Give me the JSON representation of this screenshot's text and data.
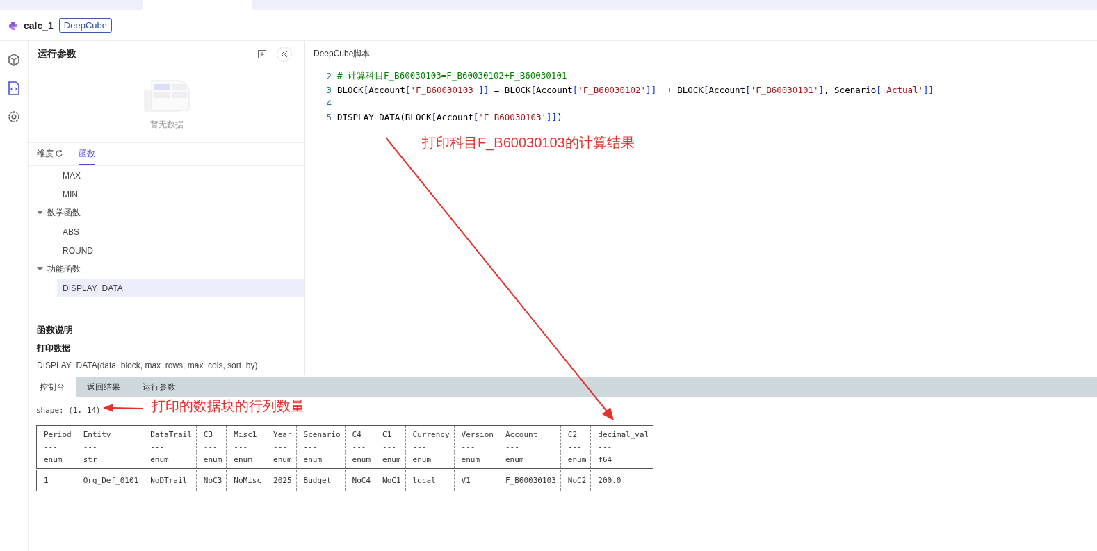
{
  "top_tabs": [
    {
      "selected": true
    }
  ],
  "header": {
    "title": "calc_1",
    "tag": "DeepCube"
  },
  "rail": [
    {
      "kind": "cube",
      "selected": false
    },
    {
      "kind": "script",
      "selected": true
    },
    {
      "kind": "settings",
      "selected": false
    }
  ],
  "params_panel": {
    "title": "运行参数",
    "empty_text": "暂无数据"
  },
  "side_tabs": [
    {
      "label": "维度",
      "selected": false,
      "refresh": true
    },
    {
      "label": "函数",
      "selected": true,
      "refresh": false
    }
  ],
  "tree": [
    {
      "kind": "leaf",
      "label": "MAX",
      "selected": false
    },
    {
      "kind": "leaf",
      "label": "MIN",
      "selected": false
    },
    {
      "kind": "group",
      "label": "数学函数",
      "expanded": true,
      "children": [
        {
          "label": "ABS",
          "selected": false
        },
        {
          "label": "ROUND",
          "selected": false
        }
      ]
    },
    {
      "kind": "group",
      "label": "功能函数",
      "expanded": true,
      "children": [
        {
          "label": "DISPLAY_DATA",
          "selected": true
        }
      ]
    }
  ],
  "description": {
    "title": "函数说明",
    "name": "打印数据",
    "signature": "DISPLAY_DATA(data_block, max_rows, max_cols, sort_by)"
  },
  "editor": {
    "title": "DeepCube脚本",
    "lines": [
      {
        "number": "2",
        "tokens": [
          {
            "kind": "comment",
            "text": "# 计算科目F_B60030103=F_B60030102+F_B60030101"
          }
        ]
      },
      {
        "number": "3",
        "tokens": [
          {
            "kind": "plain",
            "text": "BLOCK"
          },
          {
            "kind": "bracket",
            "text": "["
          },
          {
            "kind": "plain",
            "text": "Account"
          },
          {
            "kind": "bracket",
            "text": "["
          },
          {
            "kind": "string",
            "text": "'F_B60030103'"
          },
          {
            "kind": "bracket",
            "text": "]]"
          },
          {
            "kind": "plain",
            "text": " = BLOCK"
          },
          {
            "kind": "bracket",
            "text": "["
          },
          {
            "kind": "plain",
            "text": "Account"
          },
          {
            "kind": "bracket",
            "text": "["
          },
          {
            "kind": "string",
            "text": "'F_B60030102'"
          },
          {
            "kind": "bracket",
            "text": "]]"
          },
          {
            "kind": "plain",
            "text": "  + BLOCK"
          },
          {
            "kind": "bracket",
            "text": "["
          },
          {
            "kind": "plain",
            "text": "Account"
          },
          {
            "kind": "bracket",
            "text": "["
          },
          {
            "kind": "string",
            "text": "'F_B60030101'"
          },
          {
            "kind": "bracket",
            "text": "]"
          },
          {
            "kind": "plain",
            "text": ", Scenario"
          },
          {
            "kind": "bracket",
            "text": "["
          },
          {
            "kind": "string",
            "text": "'Actual'"
          },
          {
            "kind": "bracket",
            "text": "]]"
          }
        ]
      },
      {
        "number": "4"
      },
      {
        "number": "5",
        "tokens": [
          {
            "kind": "plain",
            "text": "DISPLAY_DATA(BLOCK"
          },
          {
            "kind": "bracket",
            "text": "["
          },
          {
            "kind": "plain",
            "text": "Account"
          },
          {
            "kind": "bracket",
            "text": "["
          },
          {
            "kind": "string",
            "text": "'F_B60030103'"
          },
          {
            "kind": "bracket",
            "text": "]]"
          },
          {
            "kind": "plain",
            "text": ")"
          }
        ]
      }
    ]
  },
  "annotations": [
    {
      "text": "打印科目F_B60030103的计算结果"
    },
    {
      "text": "打印的数据块的行列数量"
    }
  ],
  "bottom_tabs": [
    {
      "label": "控制台",
      "selected": true
    },
    {
      "label": "返回结果",
      "selected": false
    },
    {
      "label": "运行参数",
      "selected": false
    }
  ],
  "console": {
    "shape": "shape: (1, 14)",
    "columns": [
      {
        "name": "Period",
        "type": "enum"
      },
      {
        "name": "Entity",
        "type": "str"
      },
      {
        "name": "DataTrail",
        "type": "enum"
      },
      {
        "name": "C3",
        "type": "enum"
      },
      {
        "name": "Misc1",
        "type": "enum"
      },
      {
        "name": "Year",
        "type": "enum"
      },
      {
        "name": "Scenario",
        "type": "enum"
      },
      {
        "name": "C4",
        "type": "enum"
      },
      {
        "name": "C1",
        "type": "enum"
      },
      {
        "name": "Currency",
        "type": "enum"
      },
      {
        "name": "Version",
        "type": "enum"
      },
      {
        "name": "Account",
        "type": "enum"
      },
      {
        "name": "C2",
        "type": "enum"
      },
      {
        "name": "decimal_val",
        "type": "f64"
      }
    ],
    "separator": "---",
    "rows": [
      [
        "1",
        "Org_Def_0101",
        "NoDTrail",
        "NoC3",
        "NoMisc",
        "2025",
        "Budget",
        "NoC4",
        "NoC1",
        "local",
        "V1",
        "F_B60030103",
        "NoC2",
        "200.0"
      ]
    ]
  }
}
